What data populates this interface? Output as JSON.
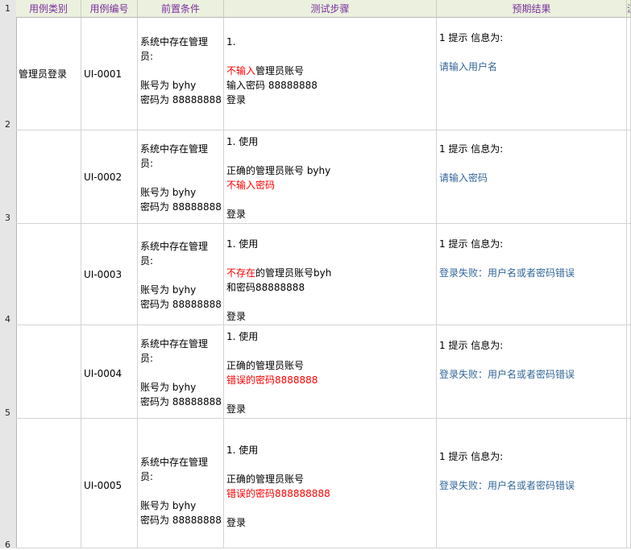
{
  "row_numbers": [
    "1",
    "2",
    "3",
    "4",
    "5",
    "6"
  ],
  "headers": [
    "用例类别",
    "用例编号",
    "前置条件",
    "测试步骤",
    "预期结果",
    "派"
  ],
  "rows": [
    {
      "category": "管理员登录",
      "id": "UI-0001",
      "precondition": [
        "系统中存在管理",
        "员:",
        "",
        "账号为 byhy",
        "密码为 88888888"
      ],
      "steps": [
        [
          {
            "t": "1."
          }
        ],
        [],
        [
          {
            "t": "不输入",
            "c": "red"
          },
          {
            "t": "管理员账号"
          }
        ],
        [
          {
            "t": "输入密码 88888888"
          }
        ],
        [
          {
            "t": "登录"
          }
        ]
      ],
      "expected_title": "1 提示 信息为:",
      "expected_msg": "请输入用户名"
    },
    {
      "category": "",
      "id": "UI-0002",
      "precondition": [
        "系统中存在管理",
        "员:",
        "",
        "账号为 byhy",
        "密码为 88888888"
      ],
      "steps": [
        [
          {
            "t": "1. 使用"
          }
        ],
        [],
        [
          {
            "t": "正确的管理员账号 byhy"
          }
        ],
        [
          {
            "t": "不输入密码",
            "c": "red"
          }
        ],
        [],
        [
          {
            "t": "登录"
          }
        ]
      ],
      "expected_title": "1 提示 信息为:",
      "expected_msg": "请输入密码"
    },
    {
      "category": "",
      "id": "UI-0003",
      "precondition": [
        "系统中存在管理",
        "员:",
        "",
        "账号为 byhy",
        "密码为 88888888"
      ],
      "steps": [
        [
          {
            "t": "1. 使用"
          }
        ],
        [],
        [
          {
            "t": "不存在",
            "c": "red"
          },
          {
            "t": "的管理员账号byh"
          }
        ],
        [
          {
            "t": "和密码88888888"
          }
        ],
        [],
        [
          {
            "t": "登录"
          }
        ]
      ],
      "expected_title": "1 提示 信息为:",
      "expected_msg": "登录失败：用户名或者密码错误"
    },
    {
      "category": "",
      "id": "UI-0004",
      "precondition": [
        "系统中存在管理",
        "员:",
        "",
        "账号为 byhy",
        "密码为 88888888"
      ],
      "steps": [
        [
          {
            "t": "1. 使用"
          }
        ],
        [],
        [
          {
            "t": "正确的管理员账号"
          }
        ],
        [
          {
            "t": "错误的密码8888888",
            "c": "red"
          }
        ],
        [],
        [
          {
            "t": "登录"
          }
        ]
      ],
      "expected_title": "1 提示 信息为:",
      "expected_msg": "登录失败：用户名或者密码错误"
    },
    {
      "category": "",
      "id": "UI-0005",
      "precondition": [
        "系统中存在管理",
        "员:",
        "",
        "账号为 byhy",
        "密码为 88888888"
      ],
      "steps": [
        [
          {
            "t": "1. 使用"
          }
        ],
        [],
        [
          {
            "t": "正确的管理员账号"
          }
        ],
        [
          {
            "t": "错误的密码888888888",
            "c": "red"
          }
        ],
        [],
        [
          {
            "t": "登录"
          }
        ]
      ],
      "expected_title": "1 提示 信息为:",
      "expected_msg": "登录失败：用户名或者密码错误"
    }
  ]
}
